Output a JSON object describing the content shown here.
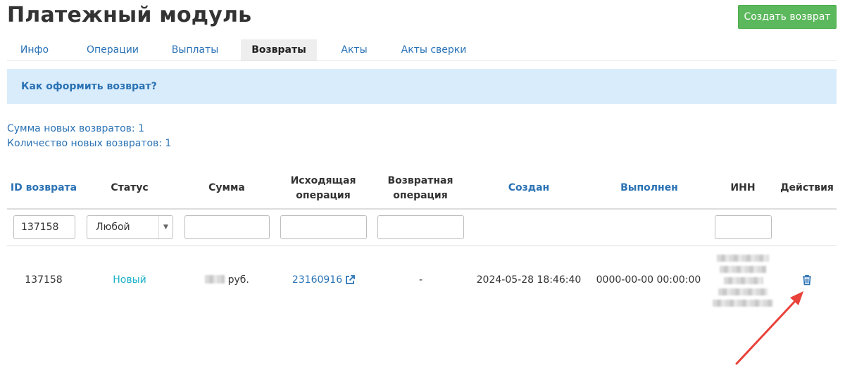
{
  "page": {
    "title": "Платежный модуль"
  },
  "toolbar": {
    "create_label": "Создать возврат"
  },
  "tabs": [
    {
      "label": "Инфо"
    },
    {
      "label": "Операции"
    },
    {
      "label": "Выплаты"
    },
    {
      "label": "Возвраты",
      "active": true
    },
    {
      "label": "Акты"
    },
    {
      "label": "Акты сверки"
    }
  ],
  "info": {
    "link_text": "Как оформить возврат?"
  },
  "summary": {
    "sum_label": "Сумма новых возвратов: 1",
    "count_label": "Количество новых возвратов: 1"
  },
  "table": {
    "headers": {
      "id": "ID возврата",
      "status": "Статус",
      "sum": "Сумма",
      "source_line1": "Исходящая",
      "source_line2": "операция",
      "return_line1": "Возвратная",
      "return_line2": "операция",
      "created": "Создан",
      "completed": "Выполнен",
      "inn": "ИНН",
      "actions": "Действия"
    },
    "filters": {
      "id_value": "137158",
      "status_selected": "Любой",
      "sum_value": "",
      "source_value": "",
      "return_value": "",
      "inn_value": ""
    },
    "rows": [
      {
        "id": "137158",
        "status": "Новый",
        "sum_currency": "руб.",
        "source_operation": "23160916",
        "return_operation": "-",
        "created": "2024-05-28 18:46:40",
        "completed": "0000-00-00 00:00:00"
      }
    ]
  },
  "icons": {
    "external": "external-link-icon",
    "delete": "trash-icon",
    "caret": "chevron-down-icon"
  },
  "colors": {
    "accent": "#2a72b5",
    "success_button": "#5cb85c",
    "info_bg": "#d9ecfb",
    "status_new": "#1ab1c8",
    "annotation_arrow": "#e8423a"
  }
}
